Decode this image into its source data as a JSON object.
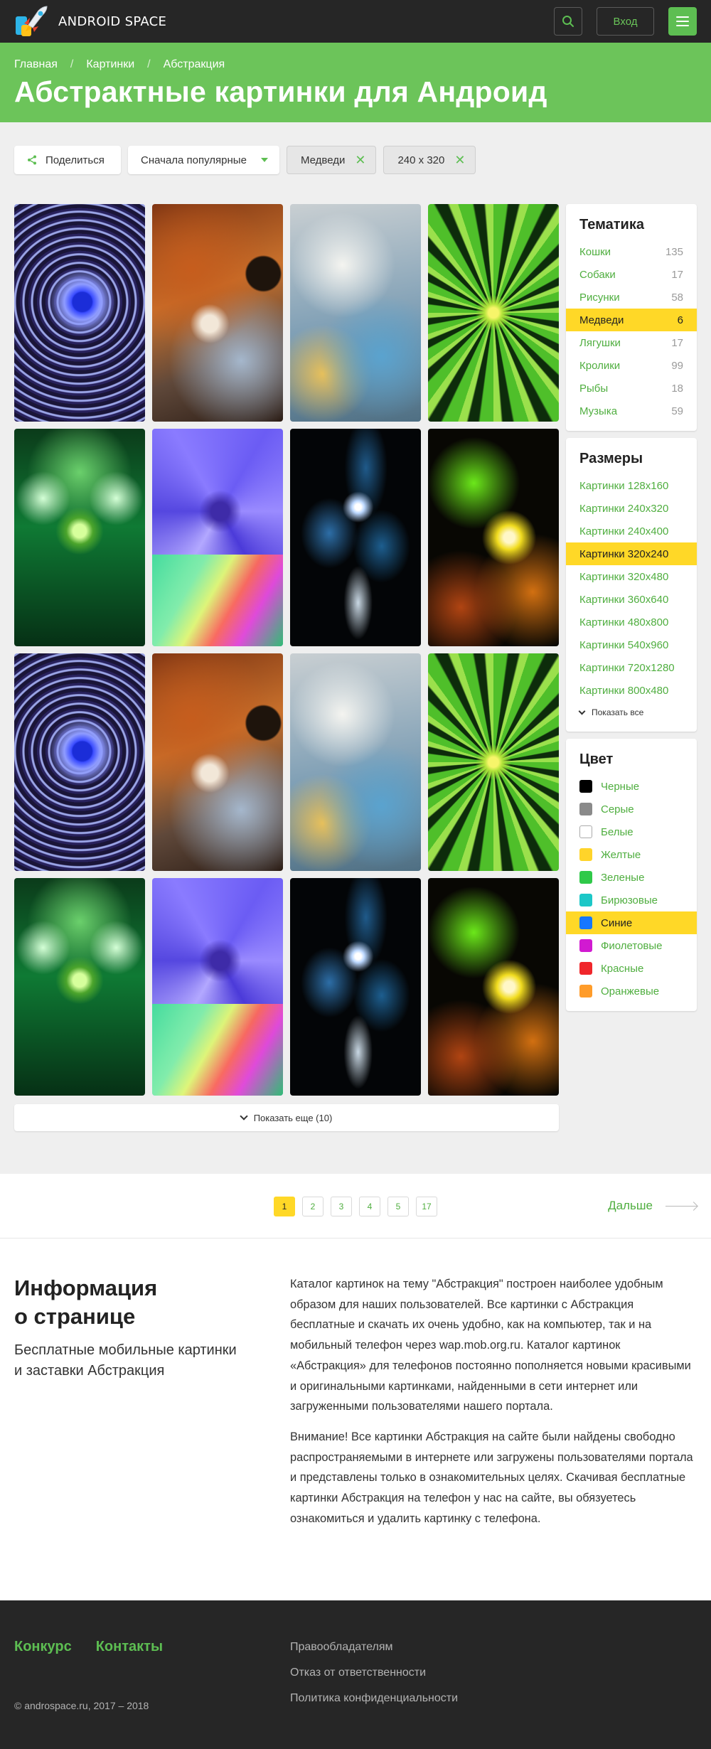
{
  "brand": {
    "name": "ANDROID SPACE"
  },
  "header": {
    "login_label": "Вход"
  },
  "breadcrumbs": [
    "Главная",
    "Картинки",
    "Абстракция"
  ],
  "page_title": "Абстрактные картинки для Андроид",
  "filters": {
    "share_label": "Поделиться",
    "sort_label": "Сначала популярные",
    "tags": [
      "Медведи",
      "240 x 320"
    ]
  },
  "gallery": {
    "images": [
      "eye",
      "nebula",
      "frost",
      "spiral",
      "green-orb",
      "purple-flower",
      "blue-dark",
      "fire",
      "eye",
      "nebula",
      "frost",
      "spiral",
      "green-orb",
      "purple-flower",
      "blue-dark",
      "fire"
    ],
    "show_more_label": "Показать еще (10)"
  },
  "sidebar": {
    "topics": {
      "title": "Тематика",
      "items": [
        {
          "label": "Кошки",
          "count": "135"
        },
        {
          "label": "Собаки",
          "count": "17"
        },
        {
          "label": "Рисунки",
          "count": "58"
        },
        {
          "label": "Медведи",
          "count": "6",
          "active": true
        },
        {
          "label": "Лягушки",
          "count": "17"
        },
        {
          "label": "Кролики",
          "count": "99"
        },
        {
          "label": "Рыбы",
          "count": "18"
        },
        {
          "label": "Музыка",
          "count": "59"
        }
      ]
    },
    "sizes": {
      "title": "Размеры",
      "items": [
        {
          "label": "Картинки 128x160"
        },
        {
          "label": "Картинки 240x320"
        },
        {
          "label": "Картинки 240x400"
        },
        {
          "label": "Картинки 320x240",
          "active": true
        },
        {
          "label": "Картинки 320x480"
        },
        {
          "label": "Картинки 360x640"
        },
        {
          "label": "Картинки 480x800"
        },
        {
          "label": "Картинки 540x960"
        },
        {
          "label": "Картинки 720x1280"
        },
        {
          "label": "Картинки 800x480"
        }
      ],
      "show_all_label": "Показать все"
    },
    "colors": {
      "title": "Цвет",
      "items": [
        {
          "label": "Черные",
          "color": "#000000"
        },
        {
          "label": "Серые",
          "color": "#8a8a8a"
        },
        {
          "label": "Белые",
          "color": "#ffffff"
        },
        {
          "label": "Желтые",
          "color": "#ffd42a"
        },
        {
          "label": "Зеленые",
          "color": "#2fc949"
        },
        {
          "label": "Бирюзовые",
          "color": "#1cc7c7"
        },
        {
          "label": "Синие",
          "color": "#1677ff",
          "active": true
        },
        {
          "label": "Фиолетовые",
          "color": "#d11ad1"
        },
        {
          "label": "Красные",
          "color": "#f0262b"
        },
        {
          "label": "Оранжевые",
          "color": "#ff9c2a"
        }
      ]
    }
  },
  "pagination": {
    "pages": [
      "1",
      "2",
      "3",
      "4",
      "5",
      "17"
    ],
    "current": "1",
    "next_label": "Дальше"
  },
  "info": {
    "title_line1": "Информация",
    "title_line2": "о странице",
    "subtitle_line1": "Бесплатные мобильные картинки",
    "subtitle_line2": "и заставки Абстракция",
    "paragraph1": "Каталог картинок на тему \"Абстракция\" построен наиболее удобным образом для наших пользователей. Все картинки с Абстракция бесплатные и скачать их очень удобно, как на компьютер, так и на мобильный телефон через wap.mob.org.ru. Каталог картинок «Абстракция» для телефонов постоянно пополняется новыми красивыми и оригинальными картинками, найденными в сети интернет или загруженными пользователями нашего портала.",
    "paragraph2": "Внимание! Все картинки Абстракция на сайте были найдены свободно распространяемыми в интернете или загружены пользователями портала и представлены только в ознакомительных целях. Скачивая бесплатные картинки Абстракция на телефон у нас на сайте, вы обязуетесь ознакомиться и удалить картинку с телефона."
  },
  "footer": {
    "links": [
      "Конкурс",
      "Контакты"
    ],
    "legal": [
      "Правообладателям",
      "Отказ от ответственности",
      "Политика конфиденциальности"
    ],
    "copyright": "© androspace.ru, 2017 – 2018"
  },
  "colors": {
    "accent_green": "#6cc45a",
    "highlight_yellow": "#ffd827",
    "dark": "#262626"
  }
}
